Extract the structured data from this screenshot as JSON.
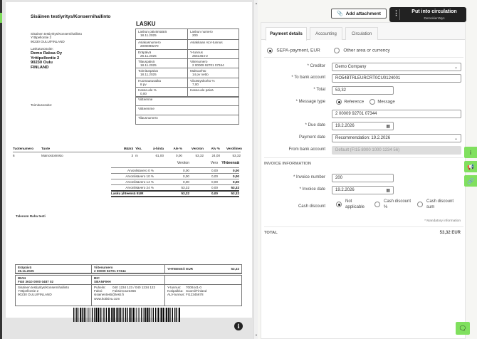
{
  "document": {
    "company_title": "Sisäinen testiyritys/Konsernihallinto",
    "sender": [
      "Sisäinen testiyritys/Konsernihallinto",
      "Yrttipellontie 2",
      "90230 OULU/FINLAND"
    ],
    "billing_label": "Laskutusosoite:",
    "billing": [
      "Demo Raksa Oy",
      "Yrttipellontie 2",
      "90230 Oulu",
      "FINLAND"
    ],
    "delivery_label": "Toimitusosoite:",
    "invoice_title": "LASKU",
    "info": [
      {
        "label": "Laskun päivämäärä",
        "value": "18.11.2025"
      },
      {
        "label": "Laskun numero",
        "value": "200"
      },
      {
        "label": "Asiakasnumero",
        "value": "2000098270"
      },
      {
        "label": "Asiakkaan ALV-tunnus",
        "value": ""
      },
      {
        "label": "Eräpäivä",
        "value": "26.11.2025"
      },
      {
        "label": "Y-tunnus",
        "value": "2551454-2"
      },
      {
        "label": "Tilauspäivä",
        "value": "18.11.2025"
      },
      {
        "label": "Viitenumero",
        "value": "2 00009 92701 07344"
      },
      {
        "label": "Toimituspäivä",
        "value": "18.11.2025"
      },
      {
        "label": "Maksuehto",
        "value": "14 pv netto"
      },
      {
        "label": "Huomautusaika",
        "value": "8 pv"
      },
      {
        "label": "Viivästyskorko %",
        "value": "7,00"
      },
      {
        "label": "Kassa-ale %",
        "value": "0,00"
      },
      {
        "label": "Kassa-ale päivä",
        "value": ""
      }
    ],
    "info_full": [
      "Viitteenne",
      "Viitteemme",
      "Tilausnumero"
    ],
    "items_header": [
      "Tuotenumero",
      "Tuote",
      "Määrä",
      "Yks.",
      "à-hinta",
      "Ale %",
      "Veroton",
      "Alv %",
      "Verollinen"
    ],
    "items": [
      [
        "6",
        "Mainostoimisto",
        "3",
        "m",
        "61,00",
        "0,00",
        "53,32",
        "24,00",
        "53,32"
      ]
    ],
    "tax_header": [
      "Veroton",
      "Vero",
      "Yhteensä"
    ],
    "tax_rows": [
      [
        "Arvonlisävero 0 %",
        "0,00",
        "0,00",
        "0,00"
      ],
      [
        "Arvonlisävero 10 %",
        "0,00",
        "0,00",
        "0,00"
      ],
      [
        "Arvonlisävero 14 %",
        "0,00",
        "0,00",
        "0,00"
      ],
      [
        "Arvonlisävero 24 %",
        "53,32",
        "0,00",
        "53,32"
      ]
    ],
    "tax_total": [
      "Lasku yhteensä EUR",
      "53,32",
      "0,00",
      "53,32"
    ],
    "note": "Talenom Raha testi",
    "slip": {
      "due_label": "Eräpäivä",
      "due": "26.11.2025",
      "ref_label": "Viitenumero",
      "ref": "2 00009 92701 07344",
      "total_label": "YHTEENSÄ EUR",
      "total": "53,32",
      "iban_label": "IBAN",
      "iban": "FI40 3610 0000 0487 02",
      "bic_label": "BIC",
      "bic": "SBANFIHH",
      "addr": [
        "Sisäinen testiyritys/Konsernihallinto",
        "Yrttipellontie 2",
        "90230 OULU/FINLAND"
      ],
      "contact": [
        [
          "Puhelin:",
          "040 1234 123 / 040 1234 122"
        ],
        [
          "Faksi:",
          "Faksinro123456"
        ],
        [
          "sisainentesti@testi.fi",
          ""
        ],
        [
          "www.kotisivu.com",
          ""
        ]
      ],
      "ids": [
        [
          "Y-tunnus:",
          "7000441-0"
        ],
        [
          "Kotipaikka:",
          "Suomi/Finland"
        ],
        [
          "ALV-tunnus:",
          "FI12345678"
        ]
      ]
    }
  },
  "toolbar": {
    "add_attachment": "Add attachment",
    "circulate": "Put into circulation",
    "circulate_sub": "Demokierrätys"
  },
  "tabs": [
    "Payment details",
    "Accounting",
    "Circulation"
  ],
  "payment": {
    "type_options": [
      "SEPA-payment, EUR",
      "Other area or currency"
    ],
    "creditor_label": "* Creditor",
    "creditor": "Demo Company",
    "account_label": "* To bank account",
    "account": "RO54BTRLEURCRT0CU0124001",
    "total_label": "* Total",
    "total": "53,32",
    "msgtype_label": "* Message type",
    "msgtype_options": [
      "Reference",
      "Message"
    ],
    "reference": "2 00009 92701 07344",
    "due_label": "* Due date",
    "due": "19.2.2026",
    "paydate_label": "Payment date",
    "paydate": "Recommendation: 19.2.2026",
    "from_label": "From bank account",
    "from": "Default (FI15 8000 1000 1234 56)"
  },
  "invoice_info": {
    "heading": "INVOICE INFORMATION",
    "number_label": "* Invoice number",
    "number": "200",
    "date_label": "* Invoice date",
    "date": "19.2.2026",
    "discount_label": "Cash discount",
    "discount_options": [
      [
        "Not",
        "applicable"
      ],
      [
        "Cash discount",
        "%"
      ],
      [
        "Cash discount",
        "sum"
      ]
    ],
    "mandatory": "* Mandatory information"
  },
  "total": {
    "label": "TOTAL",
    "value": "53,32 EUR"
  },
  "colors": {
    "accent_green": "#80e05e",
    "dark_button": "#222222"
  }
}
